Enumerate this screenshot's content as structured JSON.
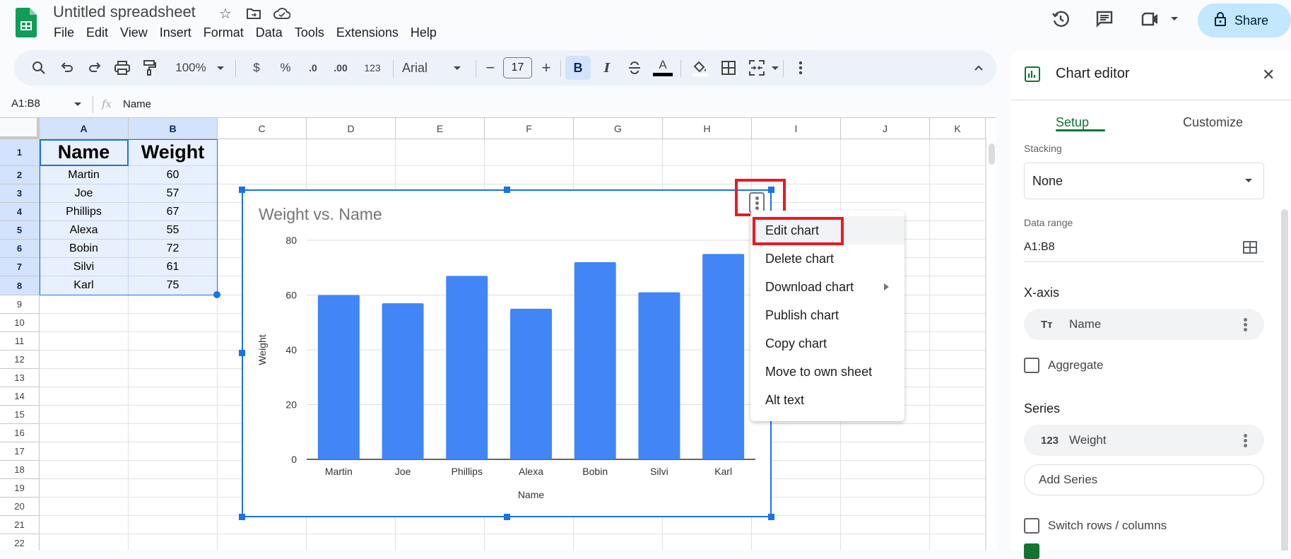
{
  "app": {
    "doc_title": "Untitled spreadsheet",
    "menu": [
      "File",
      "Edit",
      "View",
      "Insert",
      "Format",
      "Data",
      "Tools",
      "Extensions",
      "Help"
    ],
    "share_label": "Share"
  },
  "toolbar": {
    "zoom": "100%",
    "currency": "$",
    "percent": "%",
    "decrease_decimal": ".0",
    "increase_decimal": ".00",
    "number_format": "123",
    "font": "Arial",
    "font_size": "17",
    "bold": "B",
    "italic": "I",
    "text_color_label": "A"
  },
  "formula_bar": {
    "name_box": "A1:B8",
    "fx": "fx",
    "formula": "Name"
  },
  "grid": {
    "columns": [
      "A",
      "B",
      "C",
      "D",
      "E",
      "F",
      "G",
      "H",
      "I",
      "J",
      "K"
    ],
    "rows": [
      "1",
      "2",
      "3",
      "4",
      "5",
      "6",
      "7",
      "8",
      "9",
      "10",
      "11",
      "12",
      "13",
      "14",
      "15",
      "16",
      "17",
      "18",
      "19",
      "20",
      "21",
      "22"
    ],
    "headers": [
      "Name",
      "Weight"
    ],
    "data": [
      [
        "Martin",
        "60"
      ],
      [
        "Joe",
        "57"
      ],
      [
        "Phillips",
        "67"
      ],
      [
        "Alexa",
        "55"
      ],
      [
        "Bobin",
        "72"
      ],
      [
        "Silvi",
        "61"
      ],
      [
        "Karl",
        "75"
      ]
    ]
  },
  "chart_data": {
    "type": "bar",
    "title": "Weight vs. Name",
    "xlabel": "Name",
    "ylabel": "Weight",
    "categories": [
      "Martin",
      "Joe",
      "Phillips",
      "Alexa",
      "Bobin",
      "Silvi",
      "Karl"
    ],
    "series": [
      {
        "name": "Weight",
        "values": [
          60,
          57,
          67,
          55,
          72,
          61,
          75
        ],
        "color": "#4285f4"
      }
    ],
    "ylim": [
      0,
      80
    ],
    "yticks": [
      0,
      20,
      40,
      60,
      80
    ],
    "grid": true,
    "legend": "none"
  },
  "context_menu": {
    "items": [
      "Edit chart",
      "Delete chart",
      "Download chart",
      "Publish chart",
      "Copy chart",
      "Move to own sheet",
      "Alt text"
    ],
    "highlighted": "Edit chart"
  },
  "editor": {
    "title": "Chart editor",
    "tabs": [
      "Setup",
      "Customize"
    ],
    "active_tab": "Setup",
    "stacking_label": "Stacking",
    "stacking_value": "None",
    "data_range_label": "Data range",
    "data_range_value": "A1:B8",
    "xaxis_label": "X-axis",
    "xaxis_chip": "Name",
    "xaxis_chip_icon": "Tт",
    "aggregate_label": "Aggregate",
    "aggregate_checked": false,
    "series_label": "Series",
    "series_chip": "Weight",
    "series_chip_icon": "123",
    "add_series_label": "Add Series",
    "switch_label": "Switch rows / columns",
    "switch_checked": false,
    "use_row1_checked": true
  },
  "colors": {
    "accent_green": "#137333",
    "selection_blue": "#1a73e8",
    "bar_blue": "#4285f4",
    "annotation_red": "#e81b23",
    "share_bg": "#c2e7ff"
  }
}
